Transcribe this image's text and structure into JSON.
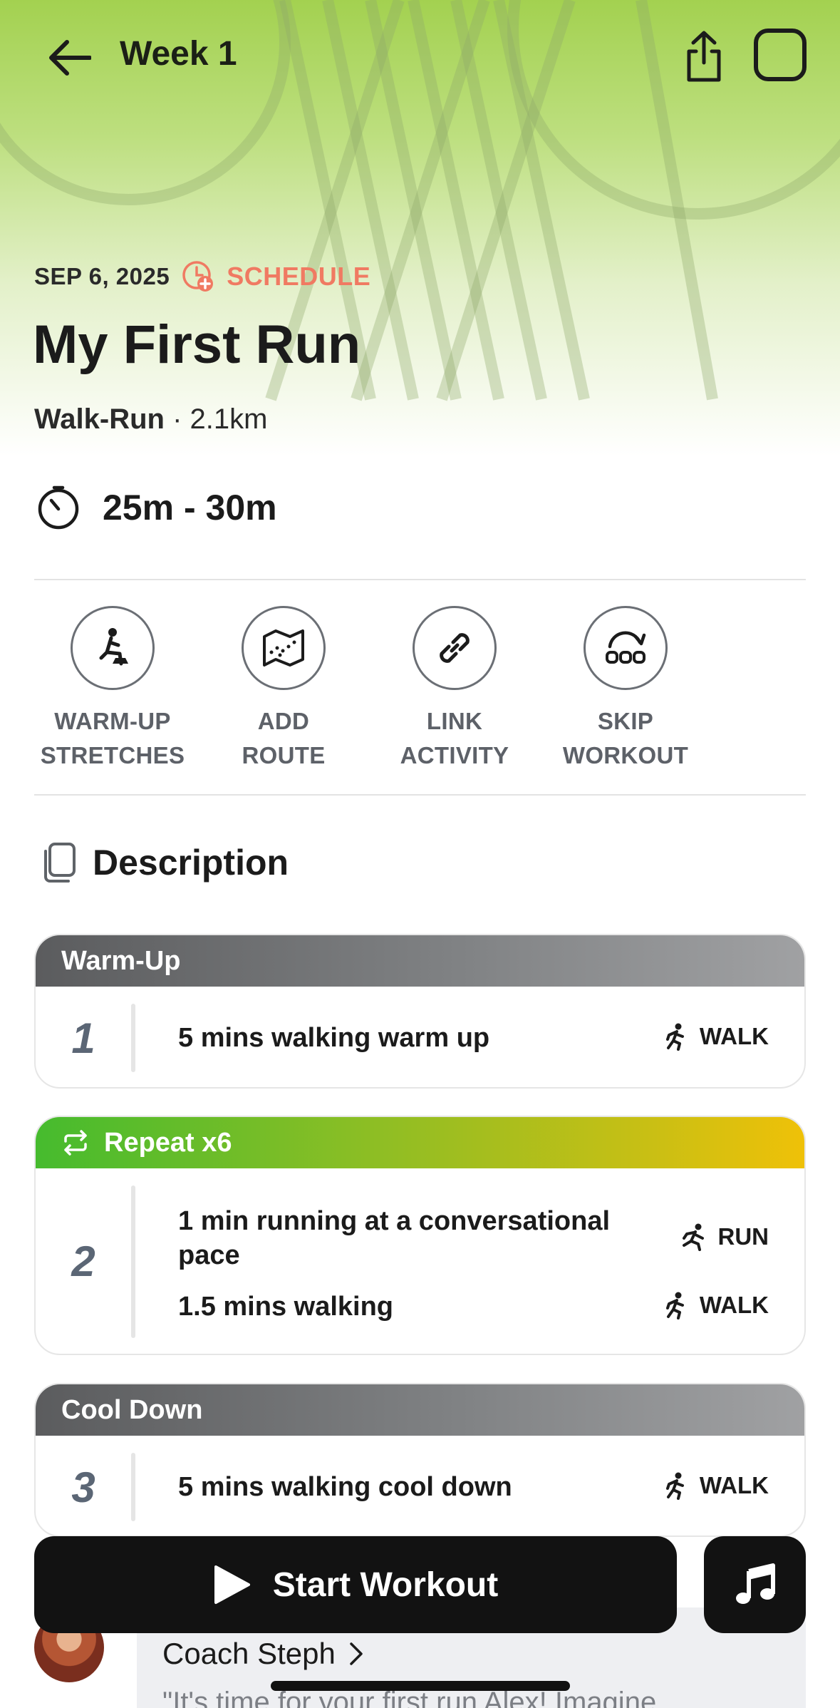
{
  "header": {
    "week_title": "Week 1"
  },
  "workout": {
    "date": "SEP 6, 2025",
    "schedule_label": "SCHEDULE",
    "title": "My First Run",
    "type": "Walk-Run",
    "distance_sep": " · 2.1km",
    "duration": "25m - 30m"
  },
  "actions": [
    {
      "label": "WARM-UP\nSTRETCHES",
      "icon": "stretch-icon"
    },
    {
      "label": "ADD\nROUTE",
      "icon": "map-icon"
    },
    {
      "label": "LINK\nACTIVITY",
      "icon": "link-icon"
    },
    {
      "label": "SKIP\nWORKOUT",
      "icon": "skip-icon"
    }
  ],
  "description": {
    "title": "Description"
  },
  "segments": {
    "warmup": {
      "header": "Warm-Up",
      "number": "1",
      "steps": [
        {
          "text": "5 mins walking warm up",
          "tag": "WALK"
        }
      ]
    },
    "repeat": {
      "header": "Repeat x6",
      "number": "2",
      "steps": [
        {
          "text": "1 min running at a conversational pace",
          "tag": "RUN"
        },
        {
          "text": "1.5 mins walking",
          "tag": "WALK"
        }
      ]
    },
    "cooldown": {
      "header": "Cool Down",
      "number": "3",
      "steps": [
        {
          "text": "5 mins walking cool down",
          "tag": "WALK"
        }
      ]
    }
  },
  "footer": {
    "start_label": "Start Workout",
    "coach_name": "Coach Steph",
    "coach_quote": "\"It's time for your first run Alex! Imagine"
  },
  "colors": {
    "accent_green": "#a3d150",
    "schedule_coral": "#f07a62",
    "repeat_gradient_start": "#46bb2e",
    "repeat_gradient_end": "#efc108",
    "button_dark": "#121212"
  }
}
